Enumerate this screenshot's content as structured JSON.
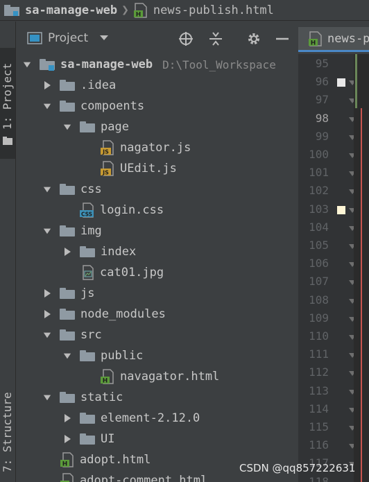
{
  "breadcrumb": {
    "project": "sa-manage-web",
    "file": "news-publish.html"
  },
  "tool_stripe": {
    "project_label": "1: Project",
    "structure_label": "7: Structure"
  },
  "panel": {
    "title": "Project",
    "icons": [
      "target-icon",
      "collapse-all-icon",
      "gear-icon",
      "minimize-icon"
    ]
  },
  "tree": [
    {
      "label": "sa-manage-web",
      "path": "D:\\Tool_Workspace",
      "type": "module",
      "depth": 0,
      "state": "open"
    },
    {
      "label": ".idea",
      "type": "folder",
      "depth": 1,
      "state": "closed"
    },
    {
      "label": "compoents",
      "type": "folder",
      "depth": 1,
      "state": "open"
    },
    {
      "label": "page",
      "type": "folder",
      "depth": 2,
      "state": "open"
    },
    {
      "label": "nagator.js",
      "type": "js",
      "depth": 3,
      "state": "none"
    },
    {
      "label": "UEdit.js",
      "type": "js",
      "depth": 3,
      "state": "none"
    },
    {
      "label": "css",
      "type": "folder",
      "depth": 1,
      "state": "open"
    },
    {
      "label": "login.css",
      "type": "css",
      "depth": 2,
      "state": "none"
    },
    {
      "label": "img",
      "type": "folder",
      "depth": 1,
      "state": "open"
    },
    {
      "label": "index",
      "type": "folder",
      "depth": 2,
      "state": "closed"
    },
    {
      "label": "cat01.jpg",
      "type": "image",
      "depth": 2,
      "state": "none"
    },
    {
      "label": "js",
      "type": "folder",
      "depth": 1,
      "state": "closed"
    },
    {
      "label": "node_modules",
      "type": "folder",
      "depth": 1,
      "state": "closed"
    },
    {
      "label": "src",
      "type": "folder",
      "depth": 1,
      "state": "open"
    },
    {
      "label": "public",
      "type": "folder",
      "depth": 2,
      "state": "open"
    },
    {
      "label": "navagator.html",
      "type": "html",
      "depth": 3,
      "state": "none"
    },
    {
      "label": "static",
      "type": "folder",
      "depth": 1,
      "state": "open"
    },
    {
      "label": "element-2.12.0",
      "type": "folder",
      "depth": 2,
      "state": "closed"
    },
    {
      "label": "UI",
      "type": "folder",
      "depth": 2,
      "state": "closed"
    },
    {
      "label": "adopt.html",
      "type": "html",
      "depth": 1,
      "state": "none"
    },
    {
      "label": "adopt-comment.html",
      "type": "html",
      "depth": 1,
      "state": "none"
    }
  ],
  "editor": {
    "tab_label": "news-publish.html",
    "line_numbers": [
      "95",
      "96",
      "97",
      "98",
      "99",
      "100",
      "101",
      "102",
      "103",
      "104",
      "105",
      "106",
      "107",
      "108",
      "109",
      "110",
      "111",
      "112",
      "113",
      "114",
      "115",
      "116",
      "117",
      "118"
    ],
    "current_line": "98"
  },
  "watermark": "CSDN @qq857222631",
  "colors": {
    "background": "#3c3f41",
    "editor_background": "#2b2b2b",
    "gutter": "#313335",
    "selected_tab_underline": "#4a88c7",
    "html_icon": "#5b9b3a",
    "js_icon": "#c79a32",
    "css_icon": "#3d8fb5"
  }
}
